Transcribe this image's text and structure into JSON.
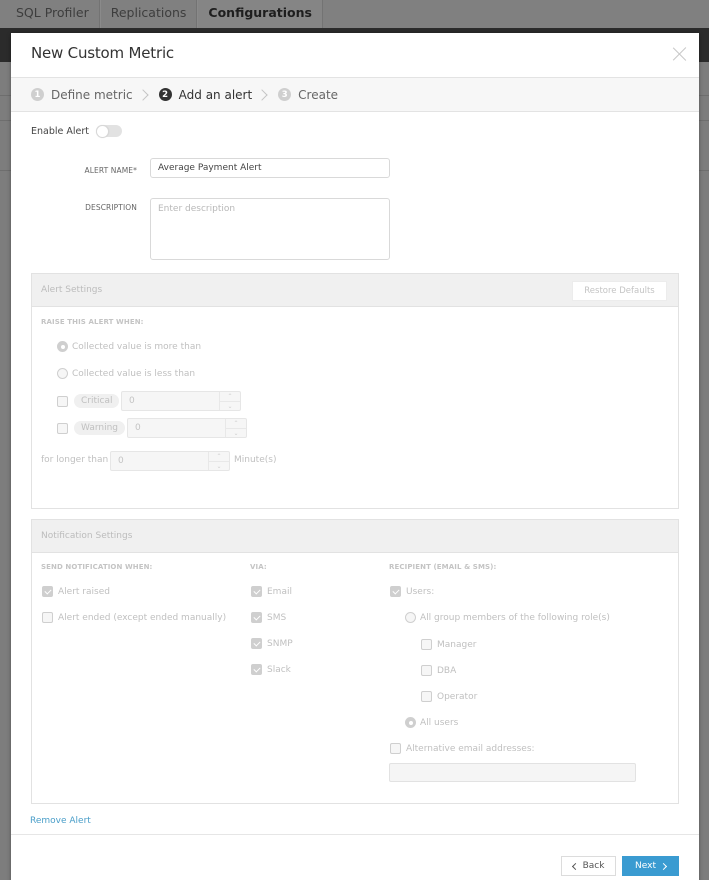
{
  "background": {
    "nav_tabs": [
      {
        "label": "SQL Profiler",
        "active": false
      },
      {
        "label": "Replications",
        "active": false
      },
      {
        "label": "Configurations",
        "active": true
      }
    ]
  },
  "modal": {
    "title": "New Custom Metric",
    "close_icon": "close-icon",
    "steps": [
      {
        "num": "1",
        "label": "Define metric",
        "active": false
      },
      {
        "num": "2",
        "label": "Add an alert",
        "active": true
      },
      {
        "num": "3",
        "label": "Create",
        "active": false
      }
    ],
    "enable_alert": {
      "label": "Enable Alert",
      "on": false
    },
    "alert_name": {
      "label": "ALERT NAME*",
      "value": "Average Payment Alert"
    },
    "description": {
      "label": "DESCRIPTION",
      "placeholder": "Enter description",
      "value": ""
    },
    "alert_settings": {
      "title": "Alert Settings",
      "restore_label": "Restore Defaults",
      "raise_label": "RAISE THIS ALERT WHEN:",
      "options": [
        {
          "label": "Collected value is more than",
          "selected": true
        },
        {
          "label": "Collected value is less than",
          "selected": false
        }
      ],
      "critical": {
        "label": "Critical",
        "checked": false,
        "value": "0"
      },
      "warning": {
        "label": "Warning",
        "checked": false,
        "value": "0"
      },
      "duration": {
        "prefix": "for longer than",
        "value": "0",
        "unit": "Minute(s)"
      }
    },
    "notification_settings": {
      "title": "Notification Settings",
      "send_when_label": "SEND NOTIFICATION WHEN:",
      "send_when": [
        {
          "label": "Alert raised",
          "checked": true
        },
        {
          "label": "Alert ended (except ended manually)",
          "checked": false
        }
      ],
      "via_label": "VIA:",
      "via": [
        {
          "label": "Email",
          "checked": true
        },
        {
          "label": "SMS",
          "checked": true
        },
        {
          "label": "SNMP",
          "checked": true
        },
        {
          "label": "Slack",
          "checked": true
        }
      ],
      "recipient_label": "RECIPIENT (EMAIL & SMS):",
      "users": {
        "label": "Users:",
        "checked": true
      },
      "group_members": {
        "label": "All group members of the following role(s)",
        "selected": false
      },
      "roles": [
        {
          "label": "Manager",
          "checked": false
        },
        {
          "label": "DBA",
          "checked": false
        },
        {
          "label": "Operator",
          "checked": false
        }
      ],
      "all_users": {
        "label": "All users",
        "selected": true
      },
      "alt_email": {
        "label": "Alternative email addresses:",
        "checked": false,
        "value": ""
      }
    },
    "remove_alert_label": "Remove Alert",
    "back_label": "Back",
    "next_label": "Next",
    "colors": {
      "accent": "#3a9bd1",
      "link": "#4a9ec9"
    }
  }
}
